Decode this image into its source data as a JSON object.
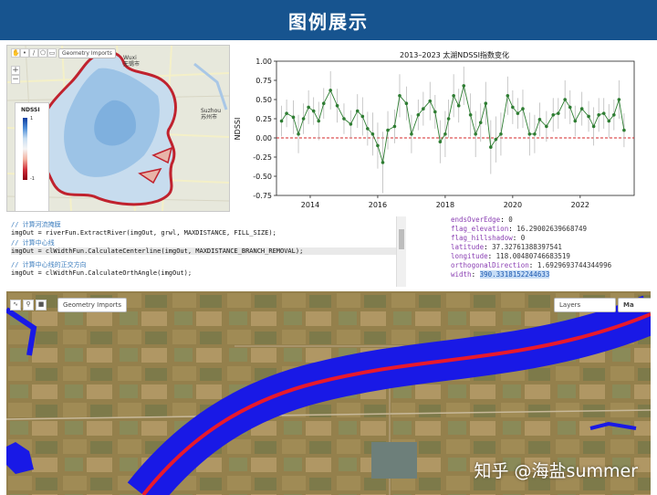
{
  "title": "图例展示",
  "map_small": {
    "geometry_imports": "Geometry Imports",
    "legend_title": "NDSSI",
    "legend_max": "1",
    "legend_min": "-1",
    "city_wuxi_en": "Wuxi",
    "city_wuxi_cn": "无锡市",
    "city_suzhou_en": "Suzhou",
    "city_suzhou_cn": "苏州市"
  },
  "chart_data": {
    "type": "line",
    "title": "2013–2023 太湖NDSSI指数变化",
    "xlabel": "",
    "ylabel": "NDSSI",
    "xlim": [
      2013.0,
      2023.6
    ],
    "ylim": [
      -0.75,
      1.0
    ],
    "xticks": [
      "2014",
      "2016",
      "2018",
      "2020",
      "2022"
    ],
    "yticks": [
      "1.00",
      "0.75",
      "0.50",
      "0.25",
      "0.00",
      "-0.25",
      "-0.50",
      "-0.75"
    ],
    "reference_line": 0.0,
    "series": [
      {
        "color": "#2e7d32",
        "x": [
          2013.15,
          2013.3,
          2013.5,
          2013.65,
          2013.8,
          2013.95,
          2014.1,
          2014.25,
          2014.4,
          2014.6,
          2014.8,
          2015.0,
          2015.2,
          2015.4,
          2015.55,
          2015.7,
          2015.85,
          2016.0,
          2016.15,
          2016.3,
          2016.5,
          2016.65,
          2016.85,
          2017.0,
          2017.2,
          2017.35,
          2017.55,
          2017.7,
          2017.85,
          2018.0,
          2018.1,
          2018.25,
          2018.4,
          2018.55,
          2018.75,
          2018.9,
          2019.05,
          2019.2,
          2019.35,
          2019.5,
          2019.65,
          2019.85,
          2020.0,
          2020.15,
          2020.3,
          2020.5,
          2020.65,
          2020.8,
          2021.0,
          2021.2,
          2021.35,
          2021.55,
          2021.7,
          2021.85,
          2022.05,
          2022.25,
          2022.4,
          2022.55,
          2022.7,
          2022.85,
          2023.0,
          2023.15,
          2023.3
        ],
        "y": [
          0.22,
          0.32,
          0.27,
          0.05,
          0.25,
          0.4,
          0.35,
          0.22,
          0.45,
          0.62,
          0.42,
          0.25,
          0.18,
          0.35,
          0.28,
          0.12,
          0.05,
          -0.1,
          -0.32,
          0.1,
          0.15,
          0.55,
          0.45,
          0.05,
          0.3,
          0.38,
          0.48,
          0.34,
          -0.05,
          0.05,
          0.25,
          0.55,
          0.42,
          0.68,
          0.3,
          0.05,
          0.2,
          0.45,
          -0.12,
          -0.02,
          0.05,
          0.55,
          0.4,
          0.32,
          0.38,
          0.05,
          0.05,
          0.24,
          0.15,
          0.3,
          0.32,
          0.5,
          0.4,
          0.22,
          0.38,
          0.28,
          0.15,
          0.3,
          0.32,
          0.22,
          0.3,
          0.5,
          0.1
        ],
        "err": [
          0.2,
          0.18,
          0.22,
          0.25,
          0.2,
          0.22,
          0.18,
          0.25,
          0.2,
          0.25,
          0.22,
          0.2,
          0.18,
          0.22,
          0.25,
          0.22,
          0.28,
          0.3,
          0.4,
          0.25,
          0.22,
          0.28,
          0.22,
          0.25,
          0.2,
          0.22,
          0.25,
          0.22,
          0.28,
          0.3,
          0.25,
          0.28,
          0.22,
          0.25,
          0.28,
          0.3,
          0.25,
          0.28,
          0.35,
          0.3,
          0.28,
          0.25,
          0.22,
          0.2,
          0.25,
          0.28,
          0.25,
          0.22,
          0.2,
          0.22,
          0.2,
          0.25,
          0.22,
          0.2,
          0.22,
          0.2,
          0.25,
          0.22,
          0.2,
          0.22,
          0.2,
          0.25,
          0.22
        ]
      }
    ]
  },
  "code": {
    "c1": "// 计算河流掩膜",
    "l1": "imgOut = riverFun.ExtractRiver(imgOut, grwl, MAXDISTANCE, FILL_SIZE);",
    "c2": "// 计算中心线",
    "l2": "imgOut = clWidthFun.CalculateCenterline(imgOut, MAXDISTANCE_BRANCH_REMOVAL);",
    "c3": "// 计算中心线的正交方向",
    "l3": "imgOut = clWidthFun.CalculateOrthAngle(imgOut);"
  },
  "props": [
    {
      "k": "endsOverEdge",
      "v": "0"
    },
    {
      "k": "flag_elevation",
      "v": "16.29002639668749"
    },
    {
      "k": "flag_hillshadow",
      "v": "0"
    },
    {
      "k": "latitude",
      "v": "37.32761388397541"
    },
    {
      "k": "longitude",
      "v": "118.00480746683519"
    },
    {
      "k": "orthogonalDirection",
      "v": "1.6929693744344996"
    },
    {
      "k": "width",
      "v": "390.3318152244633"
    }
  ],
  "map_large": {
    "geometry_imports": "Geometry Imports",
    "layers": "Layers",
    "map_btn": "Ma",
    "watermark": "知乎 @海盐summer"
  }
}
